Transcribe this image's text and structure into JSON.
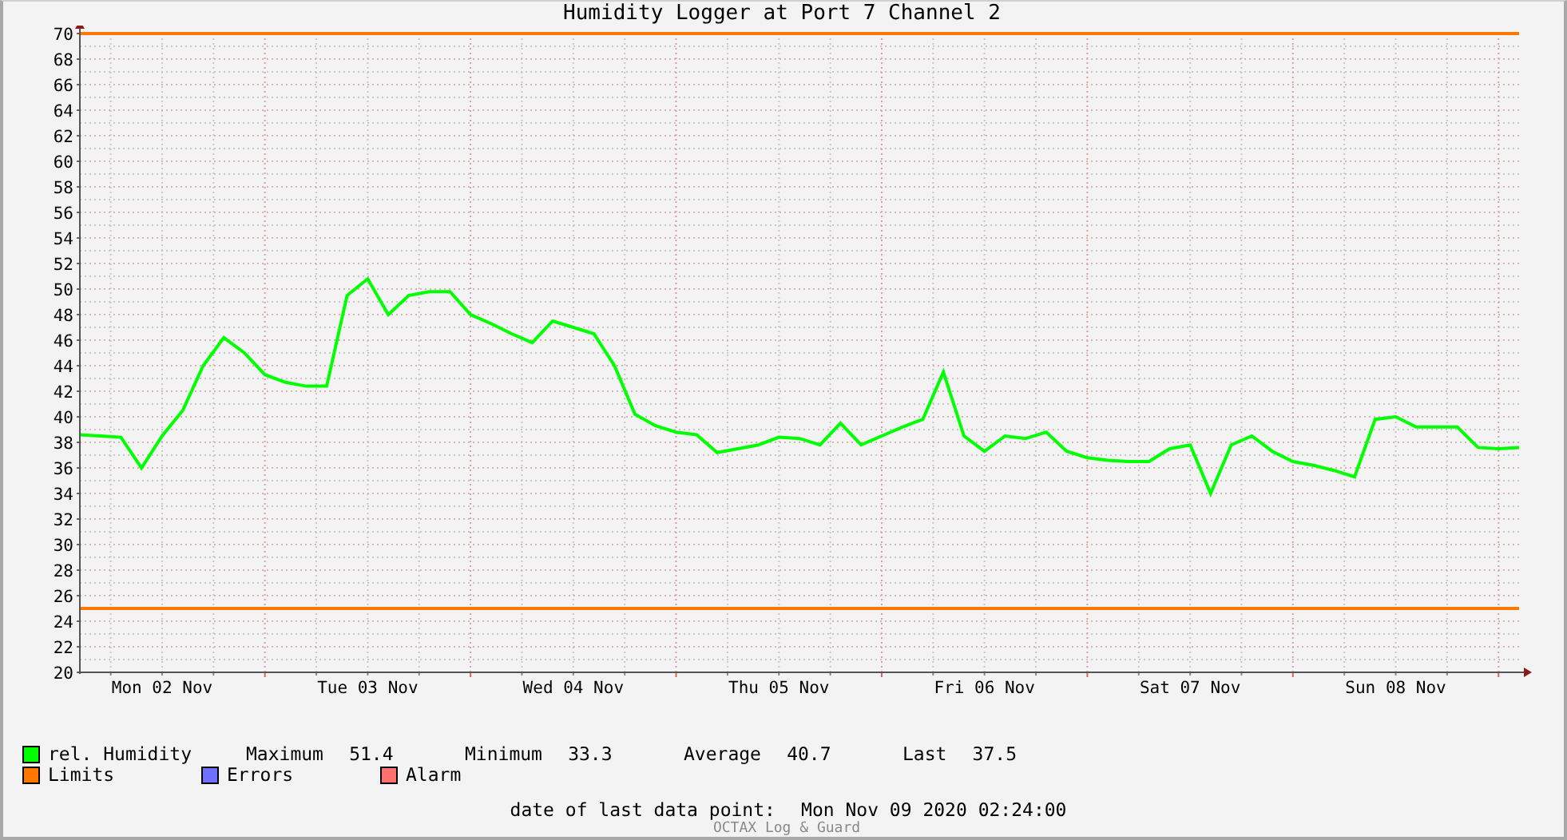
{
  "chart_data": {
    "type": "line",
    "title": "Humidity Logger at Port 7 Channel 2",
    "categories": [
      null,
      null,
      null,
      null,
      "Mon 02 Nov",
      null,
      null,
      null,
      null,
      null,
      null,
      null,
      null,
      null,
      "Tue 03 Nov",
      null,
      null,
      null,
      null,
      null,
      null,
      null,
      null,
      null,
      "Wed 04 Nov",
      null,
      null,
      null,
      null,
      null,
      null,
      null,
      null,
      null,
      "Thu 05 Nov",
      null,
      null,
      null,
      null,
      null,
      null,
      null,
      null,
      null,
      "Fri 06 Nov",
      null,
      null,
      null,
      null,
      null,
      null,
      null,
      null,
      null,
      "Sat 07 Nov",
      null,
      null,
      null,
      null,
      null,
      null,
      null,
      null,
      null,
      "Sun 08 Nov",
      null,
      null,
      null,
      null,
      null,
      null
    ],
    "series": [
      {
        "name": "rel. Humidity",
        "color": "#00ff00",
        "values": [
          38.6,
          38.5,
          38.4,
          36,
          38.5,
          40.5,
          44,
          46.2,
          45,
          43.3,
          42.7,
          42.4,
          42.4,
          49.5,
          50.8,
          48,
          49.5,
          49.8,
          49.8,
          48,
          47.3,
          46.5,
          45.8,
          47.5,
          47,
          46.5,
          44,
          40.2,
          39.3,
          38.8,
          38.6,
          37.2,
          37.5,
          37.8,
          38.4,
          38.3,
          37.8,
          39.5,
          37.8,
          38.5,
          39.2,
          39.8,
          43.5,
          38.5,
          37.3,
          38.5,
          38.3,
          38.8,
          37.3,
          36.8,
          36.6,
          36.5,
          36.5,
          37.5,
          37.8,
          34,
          37.8,
          38.5,
          37.3,
          36.5,
          36.2,
          35.8,
          35.3,
          39.8,
          40,
          39.2,
          39.2,
          39.2,
          37.6,
          37.5,
          37.6
        ]
      },
      {
        "name": "Limits",
        "color": "#ff7700",
        "values": [
          70,
          70,
          70,
          70,
          70,
          70,
          70,
          70,
          70,
          70,
          70,
          70,
          70,
          70,
          70,
          70,
          70,
          70,
          70,
          70,
          70,
          70,
          70,
          70,
          70,
          70,
          70,
          70,
          70,
          70,
          70,
          70,
          70,
          70,
          70,
          70,
          70,
          70,
          70,
          70,
          70,
          70,
          70,
          70,
          70,
          70,
          70,
          70,
          70,
          70,
          70,
          70,
          70,
          70,
          70,
          70,
          70,
          70,
          70,
          70,
          70,
          70,
          70,
          70,
          70,
          70,
          70,
          70,
          70,
          70,
          70
        ]
      },
      {
        "color": "#ff7700",
        "values": [
          25,
          25,
          25,
          25,
          25,
          25,
          25,
          25,
          25,
          25,
          25,
          25,
          25,
          25,
          25,
          25,
          25,
          25,
          25,
          25,
          25,
          25,
          25,
          25,
          25,
          25,
          25,
          25,
          25,
          25,
          25,
          25,
          25,
          25,
          25,
          25,
          25,
          25,
          25,
          25,
          25,
          25,
          25,
          25,
          25,
          25,
          25,
          25,
          25,
          25,
          25,
          25,
          25,
          25,
          25,
          25,
          25,
          25,
          25,
          25,
          25,
          25,
          25,
          25,
          25,
          25,
          25,
          25,
          25,
          25,
          25
        ]
      }
    ],
    "ylim": [
      20,
      70
    ],
    "yticks": [
      20,
      22,
      24,
      26,
      28,
      30,
      32,
      34,
      36,
      38,
      40,
      42,
      44,
      46,
      48,
      50,
      52,
      54,
      56,
      58,
      60,
      62,
      64,
      66,
      68,
      70
    ],
    "grid": true
  },
  "legend": [
    {
      "color": "#00ff00",
      "stats": [
        {
          "label": "Maximum",
          "value": "51.4"
        },
        {
          "label": "Minimum",
          "value": "33.3"
        },
        {
          "label": "Average",
          "value": "40.7"
        },
        {
          "label": "Last",
          "value": "37.5"
        }
      ]
    },
    {
      "color": "#ff7700"
    },
    {
      "label": "Errors",
      "color": "#7070ff"
    },
    {
      "label": "Alarm",
      "color": "#ff7070"
    }
  ],
  "last_data_point": {
    "label": "date of last data point:",
    "value": "Mon Nov 09 2020 02:24:00"
  },
  "footer_mark": "OCTAX Log & Guard"
}
